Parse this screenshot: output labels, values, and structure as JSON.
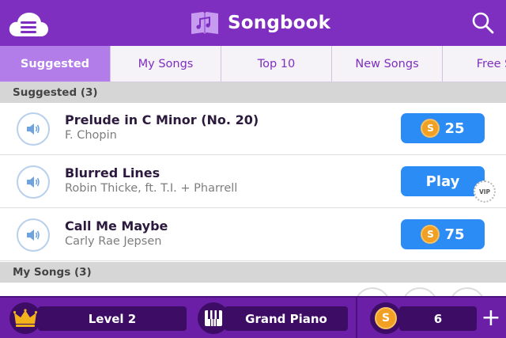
{
  "header": {
    "title": "Songbook",
    "menu_icon": "cloud-menu-icon",
    "logo_icon": "music-book-icon",
    "search_icon": "search-icon"
  },
  "tabs": [
    {
      "label": "Suggested",
      "active": true
    },
    {
      "label": "My Songs",
      "active": false
    },
    {
      "label": "Top 10",
      "active": false
    },
    {
      "label": "New Songs",
      "active": false
    },
    {
      "label": "Free So",
      "active": false
    }
  ],
  "sections": [
    {
      "title": "Suggested (3)",
      "songs": [
        {
          "title": "Prelude in C Minor (No. 20)",
          "artist": "F. Chopin",
          "action": "coin",
          "price": "25"
        },
        {
          "title": "Blurred Lines",
          "artist": "Robin Thicke, ft. T.I. + Pharrell",
          "action": "play",
          "play_label": "Play",
          "vip_label": "VIP"
        },
        {
          "title": "Call Me Maybe",
          "artist": "Carly Rae Jepsen",
          "action": "coin",
          "price": "75"
        }
      ]
    },
    {
      "title": "My Songs (3)",
      "songs": []
    }
  ],
  "bottom_bar": {
    "level_label": "Level 2",
    "instrument_label": "Grand Piano",
    "coin_count": "6",
    "coin_symbol": "S",
    "add_symbol": "+"
  },
  "colors": {
    "header_purple": "#7e2fc0",
    "active_tab": "#b27de8",
    "button_blue": "#2b8cf5",
    "coin_orange": "#f2a024",
    "bottom_bar": "#6a1fa6",
    "crown_gold": "#f2b21b"
  }
}
